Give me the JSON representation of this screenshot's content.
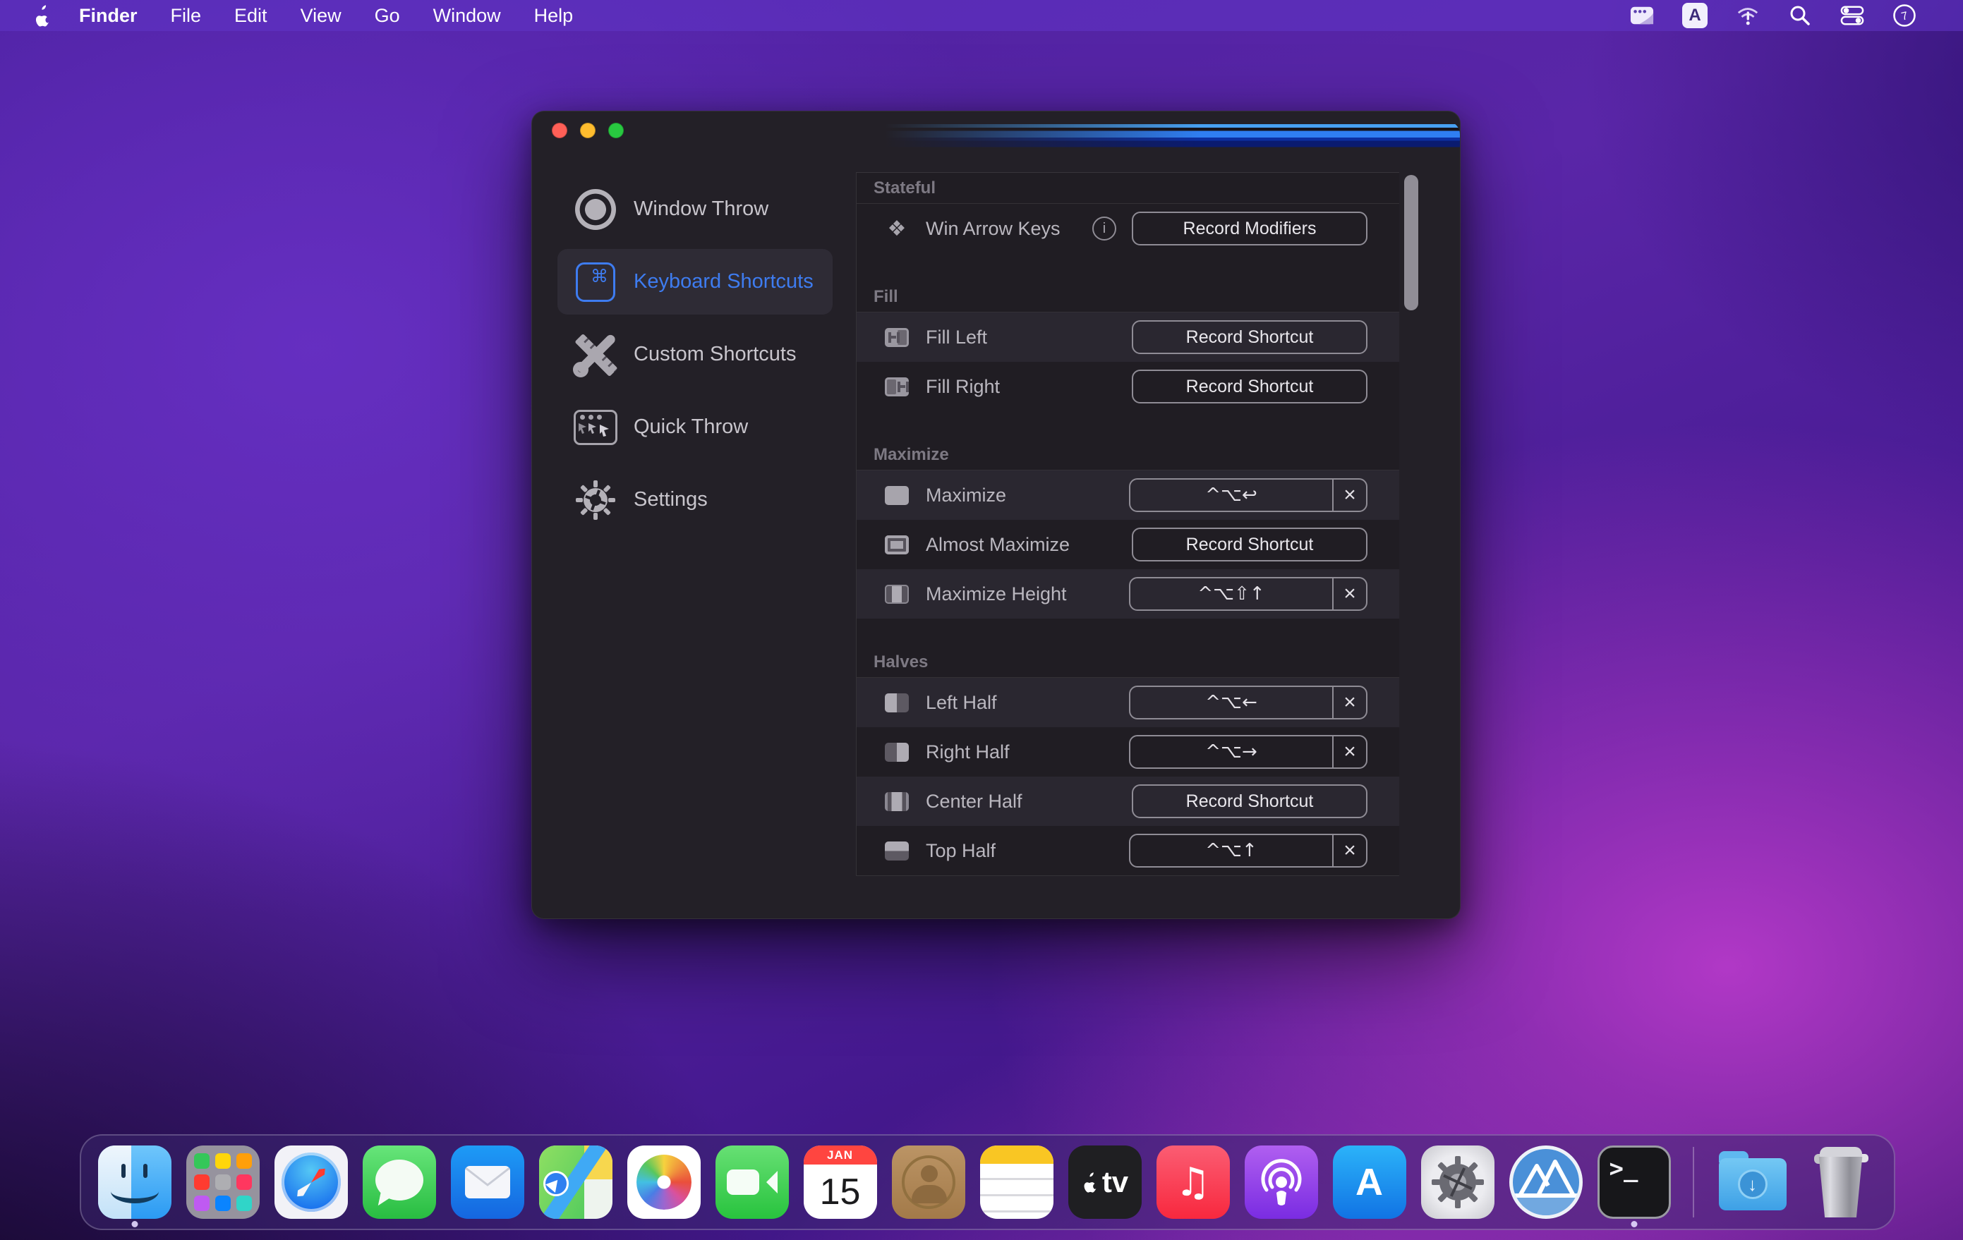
{
  "colors": {
    "accent_blue": "#3e7cf0",
    "menu_bar_bg": "#6034c6",
    "window_bg": "#232027",
    "panel_row_band": "#2a2730",
    "traffic_red": "#ff5f57",
    "traffic_yellow": "#febc2e",
    "traffic_green": "#28c840"
  },
  "menu_bar": {
    "apple_logo": "apple-icon",
    "app_name": "Finder",
    "menus": [
      "File",
      "Edit",
      "View",
      "Go",
      "Window",
      "Help"
    ],
    "input_source_label": "A",
    "status_icons": [
      "keyboard-window-icon",
      "input-source-icon",
      "wifi-alert-icon",
      "spotlight-search-icon",
      "control-center-icon",
      "clock-icon"
    ]
  },
  "window": {
    "traffic_lights": [
      "close",
      "minimize",
      "zoom"
    ],
    "sidebar": {
      "items": [
        {
          "label": "Window Throw",
          "icon": "record-circle-icon",
          "selected": false
        },
        {
          "label": "Keyboard Shortcuts",
          "icon": "command-key-icon",
          "selected": true
        },
        {
          "label": "Custom Shortcuts",
          "icon": "ruler-wrench-icon",
          "selected": false
        },
        {
          "label": "Quick Throw",
          "icon": "cursors-window-icon",
          "selected": false
        },
        {
          "label": "Settings",
          "icon": "gear-icon",
          "selected": false
        }
      ],
      "command_glyph": "⌘"
    },
    "panel": {
      "clear_glyph": "×",
      "info_glyph": "i",
      "sections": [
        {
          "title": "Stateful",
          "rows": [
            {
              "icon": "arrow-keys-icon",
              "icon_glyph": "❖",
              "label": "Win Arrow Keys",
              "has_info": true,
              "control": "button",
              "button_label": "Record Modifiers"
            }
          ]
        },
        {
          "title": "Fill",
          "rows": [
            {
              "icon": "fill-left-icon",
              "label": "Fill Left",
              "control": "button",
              "button_label": "Record Shortcut"
            },
            {
              "icon": "fill-right-icon",
              "label": "Fill Right",
              "control": "button",
              "button_label": "Record Shortcut"
            }
          ]
        },
        {
          "title": "Maximize",
          "rows": [
            {
              "icon": "maximize-icon",
              "label": "Maximize",
              "control": "shortcut",
              "keys": "^⌥↩"
            },
            {
              "icon": "almost-maximize-icon",
              "label": "Almost Maximize",
              "control": "button",
              "button_label": "Record Shortcut"
            },
            {
              "icon": "maximize-height-icon",
              "label": "Maximize Height",
              "control": "shortcut",
              "keys": "^⌥⇧↑"
            }
          ]
        },
        {
          "title": "Halves",
          "rows": [
            {
              "icon": "left-half-icon",
              "label": "Left Half",
              "control": "shortcut",
              "keys": "^⌥←"
            },
            {
              "icon": "right-half-icon",
              "label": "Right Half",
              "control": "shortcut",
              "keys": "^⌥→"
            },
            {
              "icon": "center-half-icon",
              "label": "Center Half",
              "control": "button",
              "button_label": "Record Shortcut"
            },
            {
              "icon": "top-half-icon",
              "label": "Top Half",
              "control": "shortcut",
              "keys": "^⌥↑"
            }
          ]
        }
      ]
    }
  },
  "dock": {
    "apps": [
      {
        "id": "finder",
        "name": "Finder",
        "running": true
      },
      {
        "id": "launchpad",
        "name": "Launchpad"
      },
      {
        "id": "safari",
        "name": "Safari"
      },
      {
        "id": "messages",
        "name": "Messages"
      },
      {
        "id": "mail",
        "name": "Mail"
      },
      {
        "id": "maps",
        "name": "Maps"
      },
      {
        "id": "photos",
        "name": "Photos"
      },
      {
        "id": "facetime",
        "name": "FaceTime"
      },
      {
        "id": "calendar",
        "name": "Calendar",
        "month": "JAN",
        "day": "15"
      },
      {
        "id": "contacts",
        "name": "Contacts"
      },
      {
        "id": "notes",
        "name": "Notes"
      },
      {
        "id": "appletv",
        "name": "Apple TV",
        "label": "tv"
      },
      {
        "id": "music",
        "name": "Music",
        "glyph": "♫"
      },
      {
        "id": "podcasts",
        "name": "Podcasts"
      },
      {
        "id": "appstore",
        "name": "App Store",
        "label": "A"
      },
      {
        "id": "syspref",
        "name": "System Preferences"
      },
      {
        "id": "windowapp",
        "name": "Window Manager App"
      },
      {
        "id": "terminal",
        "name": "Terminal",
        "label": ">_",
        "running": true
      },
      {
        "id": "downloads",
        "name": "Downloads",
        "glyph": "↓"
      },
      {
        "id": "trash",
        "name": "Trash"
      }
    ]
  }
}
